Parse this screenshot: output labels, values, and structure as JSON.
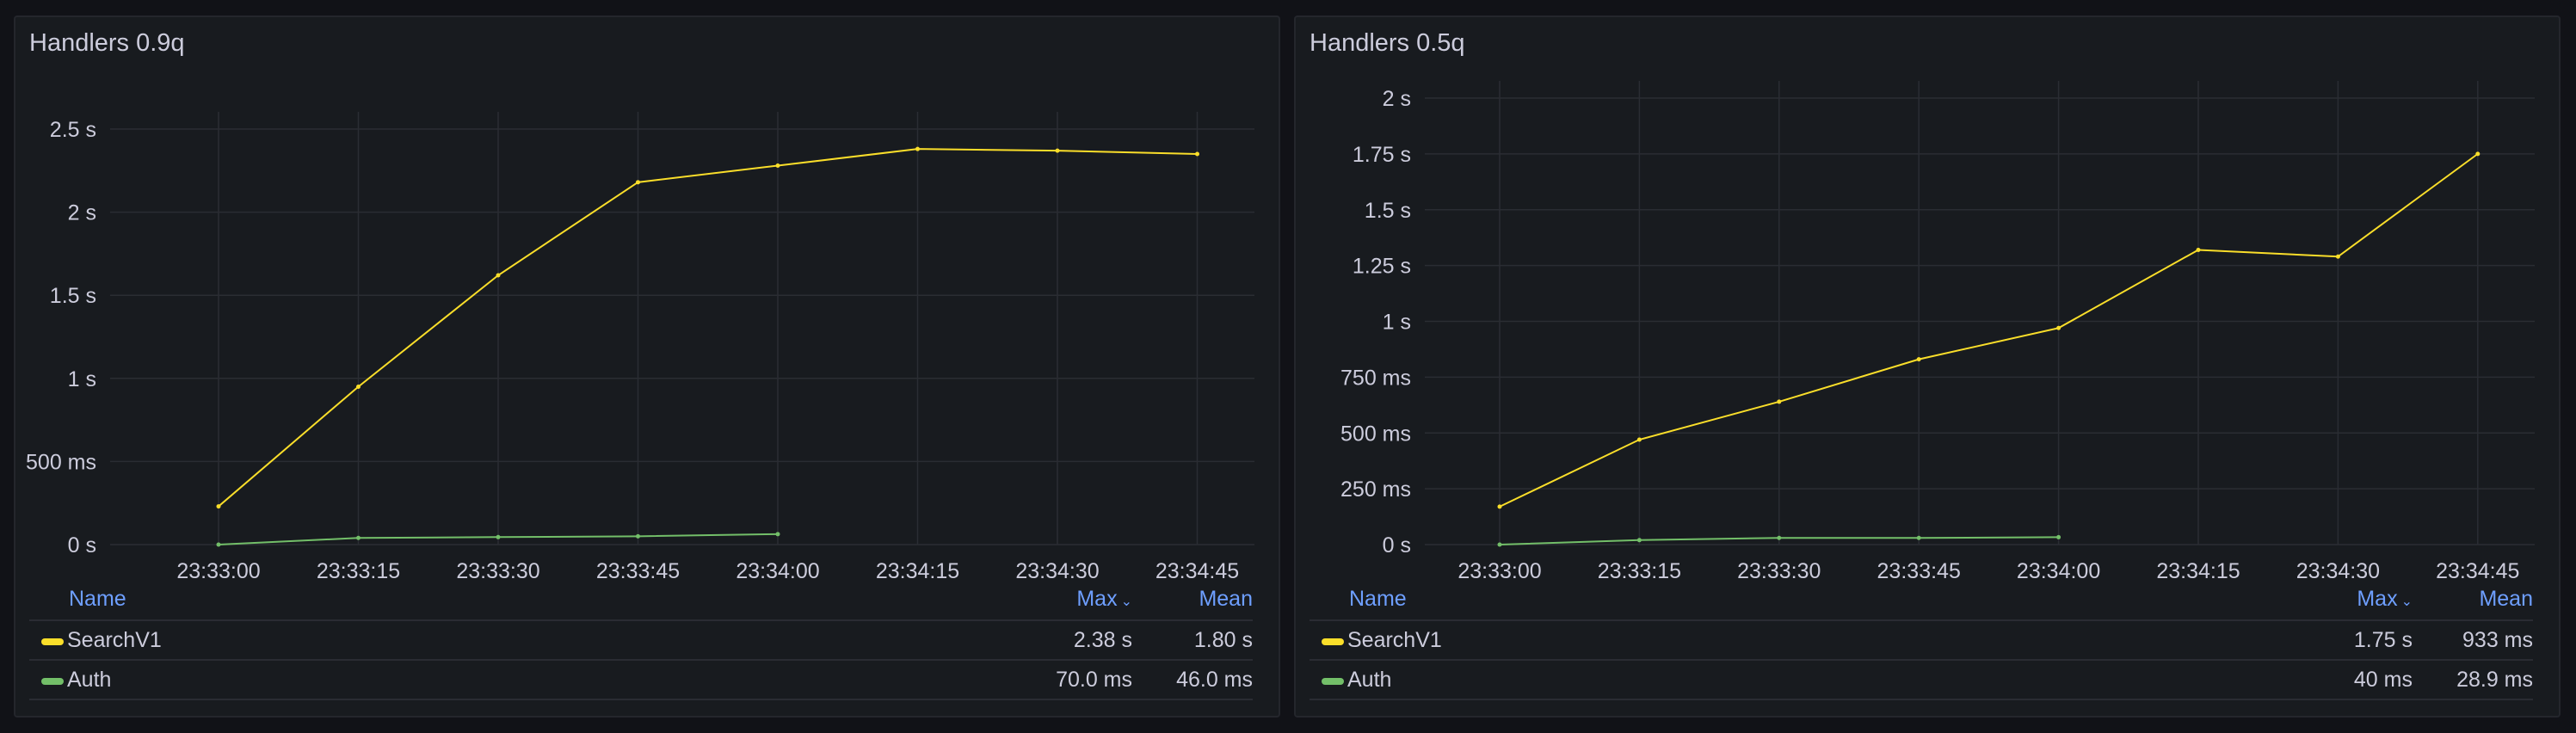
{
  "chart_data": [
    {
      "type": "line",
      "title": "Handlers 0.9q",
      "x": [
        "23:33:00",
        "23:33:15",
        "23:33:30",
        "23:33:45",
        "23:34:00",
        "23:34:15",
        "23:34:30",
        "23:34:45"
      ],
      "ylim": [
        0,
        2.5
      ],
      "ytick_values": [
        0,
        0.5,
        1,
        1.5,
        2,
        2.5
      ],
      "ytick_labels": [
        "0 s",
        "500 ms",
        "1 s",
        "1.5 s",
        "2 s",
        "2.5 s"
      ],
      "series": [
        {
          "name": "SearchV1",
          "color": "#fade2a",
          "values": [
            0.23,
            0.95,
            1.62,
            2.18,
            2.28,
            2.38,
            2.37,
            2.35
          ]
        },
        {
          "name": "Auth",
          "color": "#73bf69",
          "values": [
            0.0,
            0.04,
            0.045,
            0.05,
            0.063,
            null,
            null,
            null
          ]
        }
      ],
      "legend": {
        "headers": {
          "name": "Name",
          "max": "Max",
          "mean": "Mean",
          "sort_icon": "⌄"
        },
        "rows": [
          {
            "name": "SearchV1",
            "color": "#fade2a",
            "max": "2.38 s",
            "mean": "1.80 s"
          },
          {
            "name": "Auth",
            "color": "#73bf69",
            "max": "70.0 ms",
            "mean": "46.0 ms"
          }
        ]
      }
    },
    {
      "type": "line",
      "title": "Handlers 0.5q",
      "x": [
        "23:33:00",
        "23:33:15",
        "23:33:30",
        "23:33:45",
        "23:34:00",
        "23:34:15",
        "23:34:30",
        "23:34:45"
      ],
      "ylim": [
        0,
        2
      ],
      "ytick_values": [
        0,
        0.25,
        0.5,
        0.75,
        1,
        1.25,
        1.5,
        1.75,
        2
      ],
      "ytick_labels": [
        "0 s",
        "250 ms",
        "500 ms",
        "750 ms",
        "1 s",
        "1.25 s",
        "1.5 s",
        "1.75 s",
        "2 s"
      ],
      "series": [
        {
          "name": "SearchV1",
          "color": "#fade2a",
          "values": [
            0.17,
            0.47,
            0.64,
            0.83,
            0.97,
            1.32,
            1.29,
            1.75
          ]
        },
        {
          "name": "Auth",
          "color": "#73bf69",
          "values": [
            0.0,
            0.02,
            0.03,
            0.03,
            0.033,
            null,
            null,
            null
          ]
        }
      ],
      "legend": {
        "headers": {
          "name": "Name",
          "max": "Max",
          "mean": "Mean",
          "sort_icon": "⌄"
        },
        "rows": [
          {
            "name": "SearchV1",
            "color": "#fade2a",
            "max": "1.75 s",
            "mean": "933 ms"
          },
          {
            "name": "Auth",
            "color": "#73bf69",
            "max": "40 ms",
            "mean": "28.9 ms"
          }
        ]
      }
    }
  ]
}
